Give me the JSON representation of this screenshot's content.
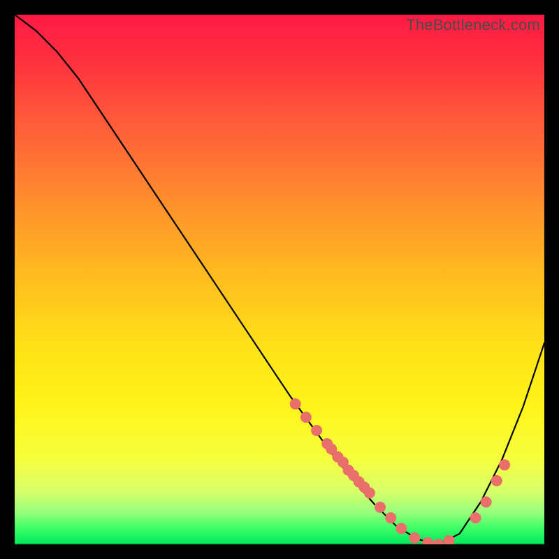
{
  "watermark": "TheBottleneck.com",
  "colors": {
    "background": "#000000",
    "curve": "#000000",
    "dot": "#e96f6b",
    "gradient_top": "#ff1a44",
    "gradient_bottom": "#00e65e"
  },
  "chart_data": {
    "type": "line",
    "title": "",
    "xlabel": "",
    "ylabel": "",
    "xlim": [
      0,
      100
    ],
    "ylim": [
      0,
      100
    ],
    "series": [
      {
        "name": "bottleneck-curve",
        "x": [
          0,
          4,
          8,
          12,
          16,
          20,
          24,
          28,
          32,
          36,
          40,
          44,
          48,
          52,
          56,
          60,
          64,
          68,
          72,
          76,
          80,
          84,
          88,
          92,
          96,
          100
        ],
        "y": [
          100,
          97,
          93,
          88,
          82,
          76,
          70,
          64,
          58,
          52,
          46,
          40,
          34,
          28,
          22.5,
          17,
          12,
          7.5,
          3.5,
          1,
          0,
          2,
          8,
          16,
          26,
          38
        ]
      }
    ],
    "markers": {
      "name": "highlighted-points",
      "x": [
        53,
        55,
        57,
        59,
        59.8,
        61,
        62,
        63,
        64,
        65,
        66,
        67,
        69,
        71,
        73,
        75.5,
        78,
        80,
        82,
        87,
        89,
        91,
        92.5
      ],
      "y": [
        26.5,
        24,
        21.5,
        19,
        18,
        16.5,
        15.5,
        14,
        13,
        11.8,
        10.8,
        9.7,
        7,
        5,
        3,
        1.2,
        0.3,
        0,
        0.7,
        5,
        8,
        12,
        15
      ]
    }
  }
}
